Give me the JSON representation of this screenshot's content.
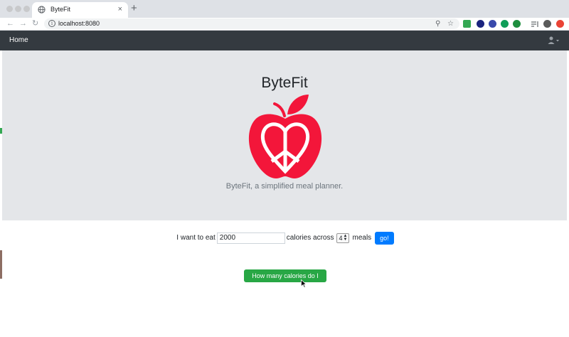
{
  "browser": {
    "tab_title": "ByteFit",
    "tab_close": "×",
    "new_tab": "+",
    "back": "←",
    "forward": "→",
    "reload": "↻",
    "info": "i",
    "url": "localhost:8080",
    "zoom": "⚲",
    "star": "☆",
    "extensions": [
      {
        "name": "ext-green-icon",
        "color": "#34a853"
      },
      {
        "name": "ext-navy-icon",
        "color": "#1a237e"
      },
      {
        "name": "ext-blue-icon",
        "color": "#3949ab"
      },
      {
        "name": "ext-teal-icon",
        "color": "#0f9d58"
      },
      {
        "name": "ext-green-circle-icon",
        "color": "#1e8e3e"
      },
      {
        "name": "ext-red-icon",
        "color": "#ea4335"
      }
    ]
  },
  "navbar": {
    "home": "Home",
    "user_icon": "user-icon",
    "bg": "#343a40"
  },
  "hero": {
    "title": "ByteFit",
    "logo": "apple-peace-heart-logo",
    "logo_color": "#f3163a",
    "tagline": "ByteFit, a simplified meal planner."
  },
  "form": {
    "label_prefix": "I want to eat",
    "calories_value": "2000",
    "label_middle": "calories across",
    "meals_value": "4",
    "label_suffix": "meals",
    "go_label": "go!",
    "go_color": "#007bff"
  },
  "need_button": {
    "label": "How many calories do I need?",
    "color": "#28a745"
  }
}
